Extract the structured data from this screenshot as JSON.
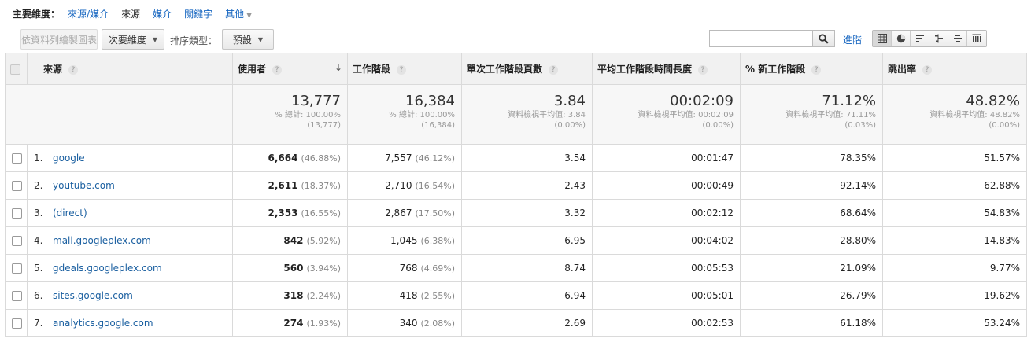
{
  "dimension_bar": {
    "label": "主要維度：",
    "items": [
      "來源/媒介",
      "來源",
      "媒介",
      "關鍵字"
    ],
    "active_index": 1,
    "other": "其他"
  },
  "toolbar": {
    "plot_rows": "依資料列繪製圖表",
    "secondary_dimension": "次要維度",
    "sort_type_label": "排序類型：",
    "sort_type_value": "預設",
    "search_placeholder": "",
    "advanced": "進階"
  },
  "table": {
    "headers": [
      "來源",
      "使用者",
      "工作階段",
      "單次工作階段頁數",
      "平均工作階段時間長度",
      "% 新工作階段",
      "跳出率"
    ],
    "totals": [
      {
        "value": "13,777",
        "sub1": "% 總計: 100.00%",
        "sub2": "(13,777)"
      },
      {
        "value": "16,384",
        "sub1": "% 總計: 100.00%",
        "sub2": "(16,384)"
      },
      {
        "value": "3.84",
        "sub1": "資料檢視平均值: 3.84",
        "sub2": "(0.00%)"
      },
      {
        "value": "00:02:09",
        "sub1": "資料檢視平均值: 00:02:09",
        "sub2": "(0.00%)"
      },
      {
        "value": "71.12%",
        "sub1": "資料檢視平均值: 71.11%",
        "sub2": "(0.03%)"
      },
      {
        "value": "48.82%",
        "sub1": "資料檢視平均值: 48.82%",
        "sub2": "(0.00%)"
      }
    ],
    "rows": [
      {
        "num": "1.",
        "source": "google",
        "users": "6,664",
        "users_pct": "(46.88%)",
        "sessions": "7,557",
        "sessions_pct": "(46.12%)",
        "pages": "3.54",
        "duration": "00:01:47",
        "new": "78.35%",
        "bounce": "51.57%"
      },
      {
        "num": "2.",
        "source": "youtube.com",
        "users": "2,611",
        "users_pct": "(18.37%)",
        "sessions": "2,710",
        "sessions_pct": "(16.54%)",
        "pages": "2.43",
        "duration": "00:00:49",
        "new": "92.14%",
        "bounce": "62.88%"
      },
      {
        "num": "3.",
        "source": "(direct)",
        "users": "2,353",
        "users_pct": "(16.55%)",
        "sessions": "2,867",
        "sessions_pct": "(17.50%)",
        "pages": "3.32",
        "duration": "00:02:12",
        "new": "68.64%",
        "bounce": "54.83%"
      },
      {
        "num": "4.",
        "source": "mall.googleplex.com",
        "users": "842",
        "users_pct": "(5.92%)",
        "sessions": "1,045",
        "sessions_pct": "(6.38%)",
        "pages": "6.95",
        "duration": "00:04:02",
        "new": "28.80%",
        "bounce": "14.83%"
      },
      {
        "num": "5.",
        "source": "gdeals.googleplex.com",
        "users": "560",
        "users_pct": "(3.94%)",
        "sessions": "768",
        "sessions_pct": "(4.69%)",
        "pages": "8.74",
        "duration": "00:05:53",
        "new": "21.09%",
        "bounce": "9.77%"
      },
      {
        "num": "6.",
        "source": "sites.google.com",
        "users": "318",
        "users_pct": "(2.24%)",
        "sessions": "418",
        "sessions_pct": "(2.55%)",
        "pages": "6.94",
        "duration": "00:05:01",
        "new": "26.79%",
        "bounce": "19.62%"
      },
      {
        "num": "7.",
        "source": "analytics.google.com",
        "users": "274",
        "users_pct": "(1.93%)",
        "sessions": "340",
        "sessions_pct": "(2.08%)",
        "pages": "2.69",
        "duration": "00:02:53",
        "new": "61.18%",
        "bounce": "53.24%"
      }
    ]
  },
  "icons": [
    "search-icon",
    "table-view-icon",
    "pie-view-icon",
    "bar-view-icon",
    "comparison-view-icon",
    "term-cloud-view-icon",
    "pivot-view-icon",
    "help-icon",
    "sort-arrow-icon",
    "dropdown-caret-icon"
  ],
  "colors": {
    "link": "#1a5fa0",
    "header_bg": "#f1f1f1",
    "total_bg": "#f7f7f7"
  }
}
